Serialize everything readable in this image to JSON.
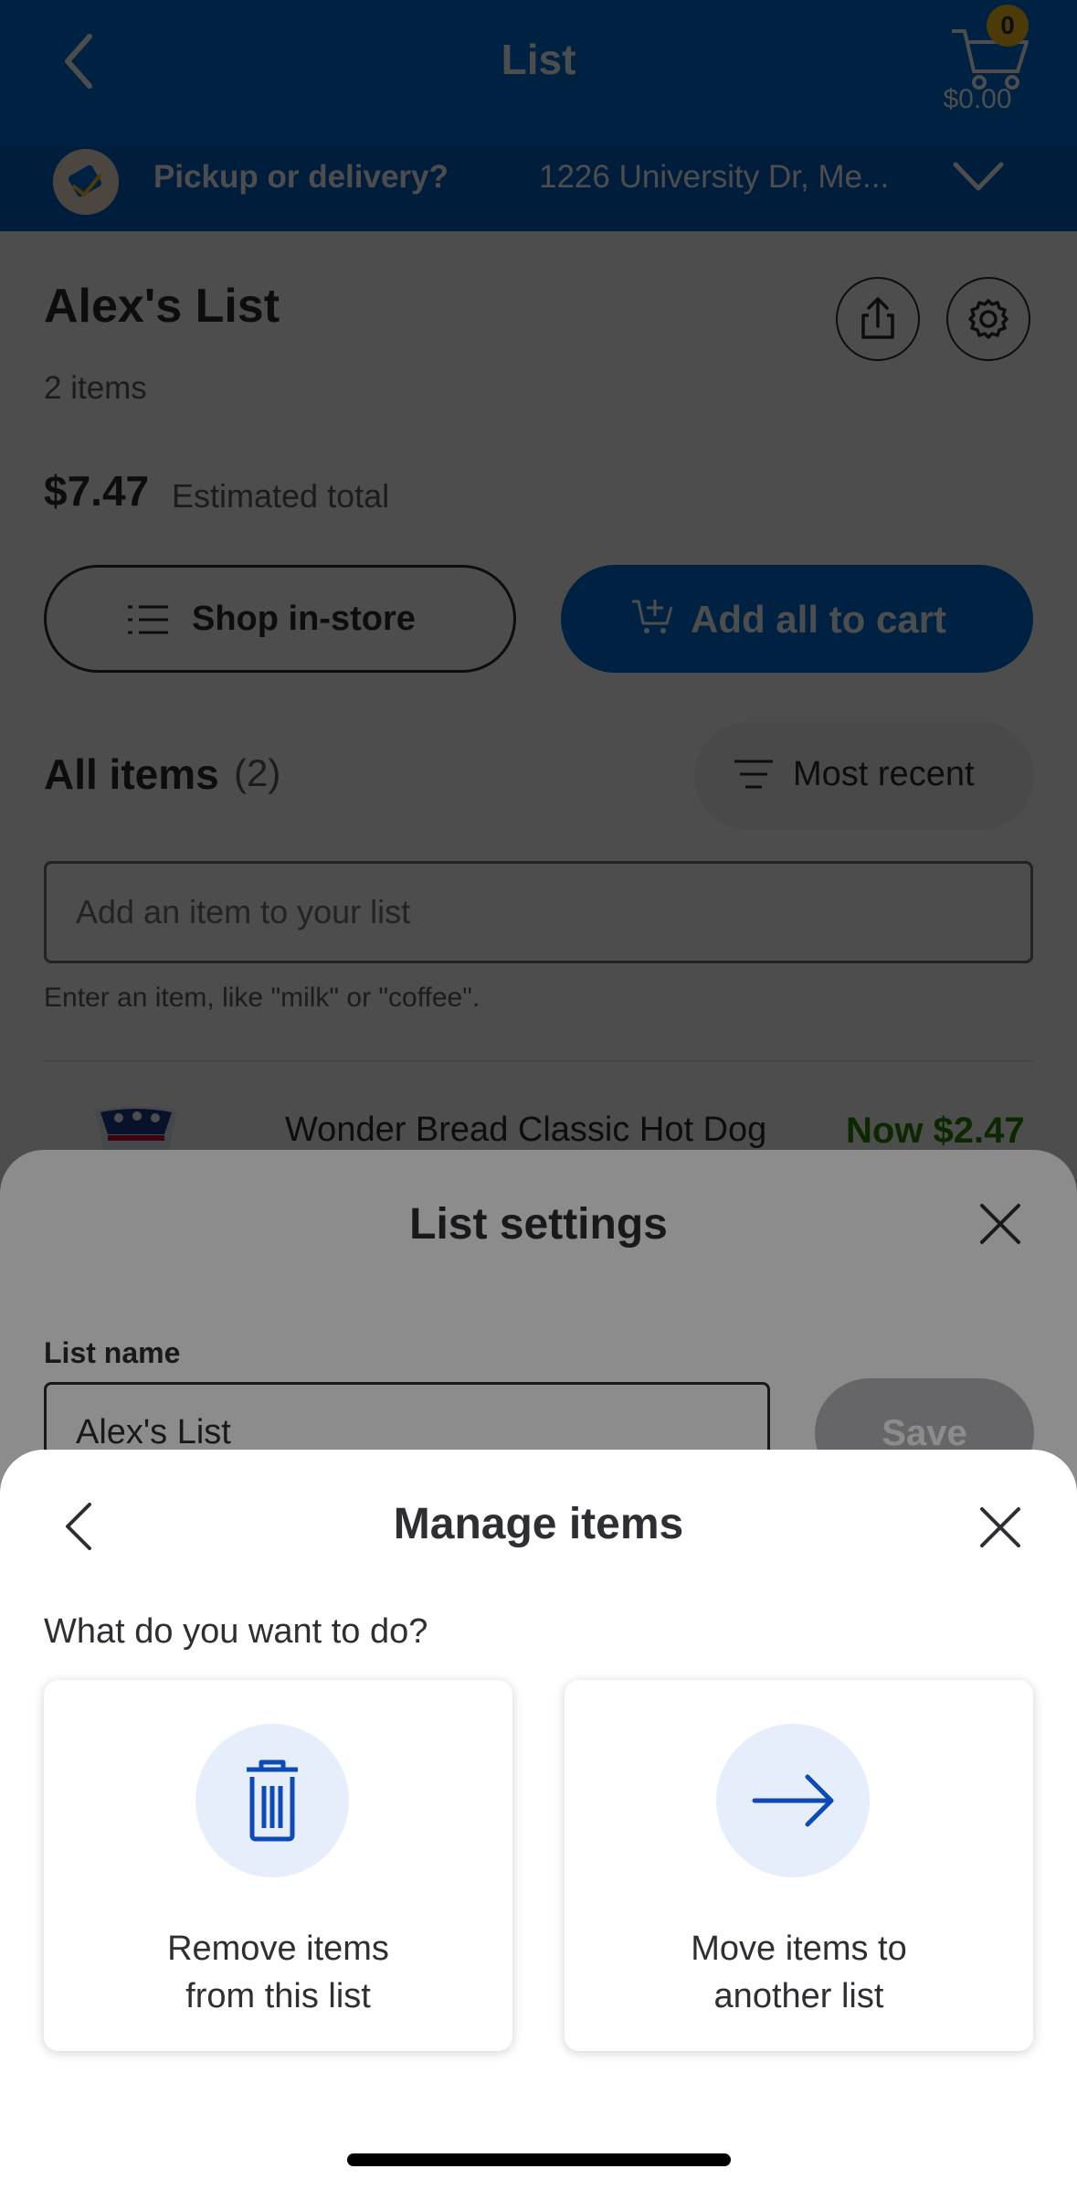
{
  "header": {
    "title": "List",
    "cart_count": "0",
    "cart_total": "$0.00",
    "pickup_label": "Pickup or delivery?",
    "address": "1226 University Dr, Me..."
  },
  "list": {
    "name": "Alex's List",
    "item_count": "2 items",
    "total": "$7.47",
    "total_label": "Estimated total",
    "shop_in_store": "Shop in-store",
    "add_all_to_cart": "Add all to cart",
    "all_items_label": "All items",
    "all_items_count": "(2)",
    "sort_label": "Most recent",
    "add_placeholder": "Add an item to your list",
    "add_hint": "Enter an item, like \"milk\" or \"coffee\".",
    "items": [
      {
        "name": "Wonder Bread Classic Hot Dog",
        "price": "Now $2.47"
      }
    ]
  },
  "list_settings": {
    "title": "List settings",
    "list_name_label": "List name",
    "list_name_value": "Alex's List",
    "save_label": "Save"
  },
  "manage_items": {
    "title": "Manage items",
    "question": "What do you want to do?",
    "options": [
      {
        "line1": "Remove items",
        "line2": "from this list",
        "icon": "trash-icon"
      },
      {
        "line1": "Move items to",
        "line2": "another list",
        "icon": "arrow-right-icon"
      }
    ]
  },
  "colors": {
    "brand_blue": "#0071dc",
    "spark_yellow": "#ffc220",
    "price_green": "#2a8703",
    "icon_circle_bg": "#e6eefb",
    "icon_blue": "#0b4ab8"
  }
}
